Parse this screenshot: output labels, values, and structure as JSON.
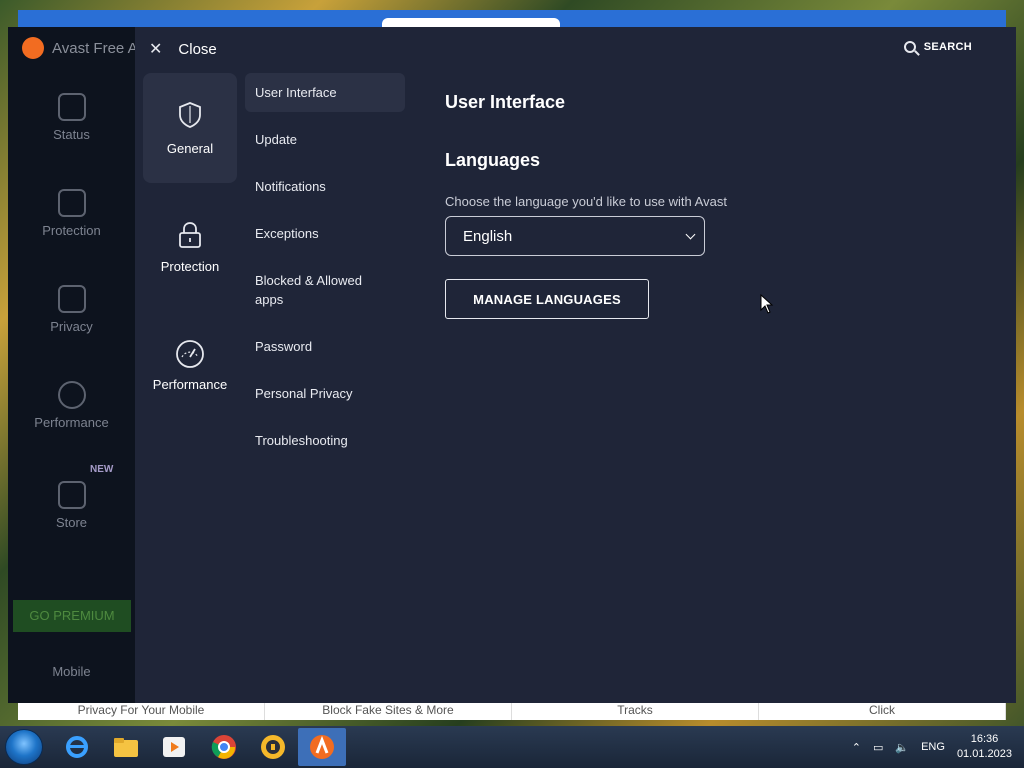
{
  "background_strip": [
    "Privacy For Your Mobile",
    "Block Fake Sites & More",
    "Tracks",
    "Click"
  ],
  "app": {
    "title": "Avast Free A",
    "sidebar": [
      "Status",
      "Protection",
      "Privacy",
      "Performance",
      "Store",
      "Mobile"
    ],
    "new_badge": "NEW",
    "go_premium": "GO PREMIUM"
  },
  "settings": {
    "close_label": "Close",
    "search_label": "SEARCH",
    "categories": [
      {
        "label": "General",
        "icon": "shield-icon"
      },
      {
        "label": "Protection",
        "icon": "lock-icon"
      },
      {
        "label": "Performance",
        "icon": "gauge-icon"
      }
    ],
    "subnav": [
      "User Interface",
      "Update",
      "Notifications",
      "Exceptions",
      "Blocked & Allowed apps",
      "Password",
      "Personal Privacy",
      "Troubleshooting"
    ],
    "page_title": "User Interface",
    "languages": {
      "title": "Languages",
      "description": "Choose the language you'd like to use with Avast",
      "selected": "English",
      "manage_label": "MANAGE LANGUAGES"
    }
  },
  "taskbar": {
    "language": "ENG",
    "time": "16:36",
    "date": "01.01.2023"
  },
  "colors": {
    "panel": "#1f2538",
    "active_item": "#2b3145",
    "avast_orange": "#f26c21"
  }
}
